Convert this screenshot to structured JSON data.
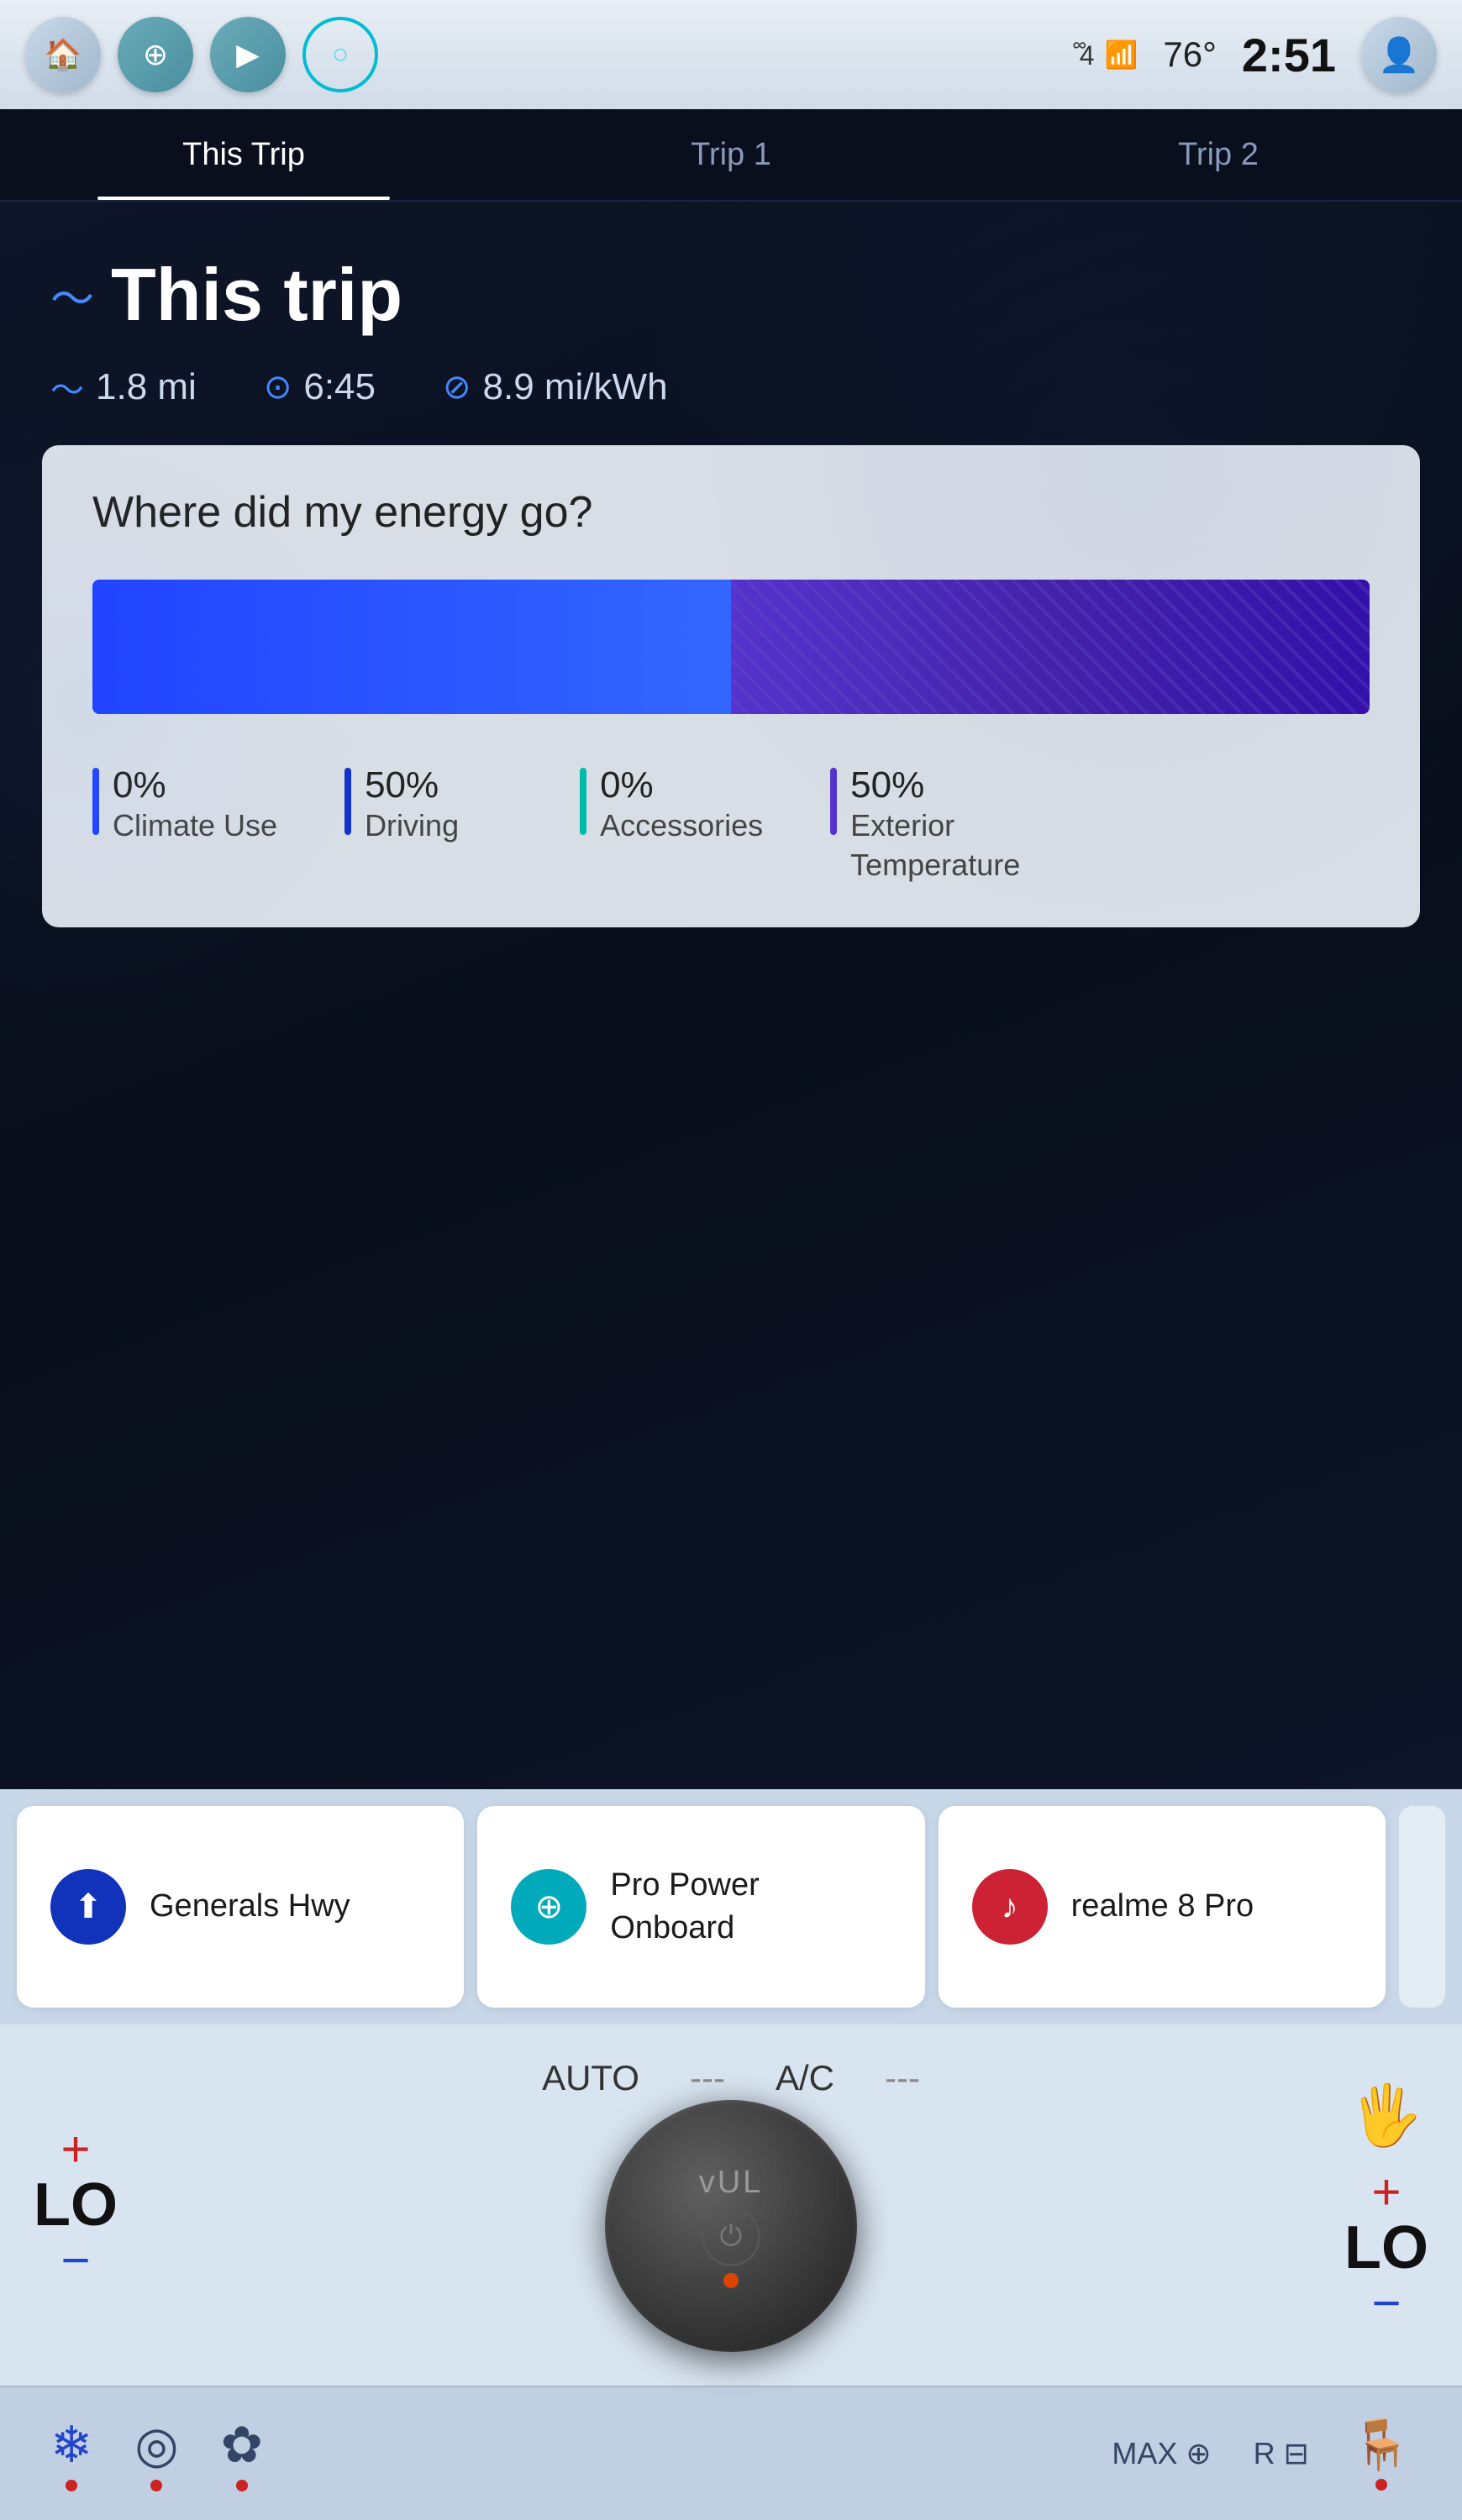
{
  "statusBar": {
    "temperature": "76°",
    "time": "2:51",
    "icons": {
      "signal": "᪲4",
      "wifi": "▐▐▐▐",
      "battery": "▐▐▐"
    }
  },
  "tabs": [
    {
      "id": "this-trip",
      "label": "This Trip",
      "active": true
    },
    {
      "id": "trip1",
      "label": "Trip 1",
      "active": false
    },
    {
      "id": "trip2",
      "label": "Trip 2",
      "active": false
    }
  ],
  "tripHeader": {
    "title": "This trip",
    "stats": [
      {
        "icon": "~",
        "value": "1.8 mi",
        "label": "distance"
      },
      {
        "icon": "⊙",
        "value": "6:45",
        "label": "time"
      },
      {
        "icon": "⊘",
        "value": "8.9 mi/kWh",
        "label": "efficiency"
      }
    ]
  },
  "energySection": {
    "title": "Where did my energy go?",
    "bars": [
      {
        "label": "blue",
        "width": 50,
        "color": "#2244ff"
      },
      {
        "label": "purple",
        "width": 50,
        "color": "#4422aa"
      }
    ],
    "legend": [
      {
        "percent": "0%",
        "label": "Climate Use",
        "color": "#2244ff"
      },
      {
        "percent": "50%",
        "label": "Driving",
        "color": "#1133cc"
      },
      {
        "percent": "0%",
        "label": "Accessories",
        "color": "#00bbaa"
      },
      {
        "percent": "50%",
        "label": "Exterior\nTemperature",
        "color": "#5533cc"
      }
    ]
  },
  "bottomCards": [
    {
      "id": "generals-hwy",
      "label": "Generals Hwy",
      "iconType": "blue-nav",
      "iconSymbol": "⬆"
    },
    {
      "id": "pro-power-onboard",
      "label": "Pro Power\nOnboard",
      "iconType": "cyan-power",
      "iconSymbol": "⊕"
    },
    {
      "id": "realme-8-pro",
      "label": "realme 8 Pro",
      "iconType": "red-music",
      "iconSymbol": "♪"
    }
  ],
  "climate": {
    "leftTemp": "LO",
    "leftMode": "AUTO",
    "leftDash": "---",
    "leftAC": "A/C",
    "knobLabel": "vUL",
    "rightTemp": "LO",
    "heatedSeatActive": true
  },
  "fnBar": {
    "leftIcons": [
      {
        "id": "fan-icon",
        "symbol": "❄",
        "hasRedDot": true
      },
      {
        "id": "steering-heat-icon",
        "symbol": "◎"
      },
      {
        "id": "fan-speed-icon",
        "symbol": "✿"
      }
    ],
    "rightIcons": [
      {
        "id": "max-defrost",
        "label": "MAX ⊕"
      },
      {
        "id": "rear-defrost",
        "label": "R ⊟"
      },
      {
        "id": "seat-icon",
        "symbol": "🪑"
      }
    ]
  }
}
